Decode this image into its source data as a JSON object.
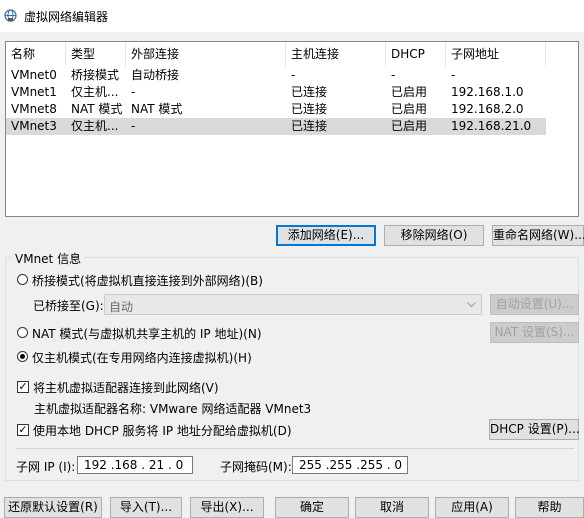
{
  "window": {
    "title": "虚拟网络编辑器",
    "icon": "network-globe-icon"
  },
  "network_table": {
    "columns": [
      "名称",
      "类型",
      "外部连接",
      "主机连接",
      "DHCP",
      "子网地址"
    ],
    "rows": [
      [
        "VMnet0",
        "桥接模式",
        "自动桥接",
        "-",
        "-",
        "-"
      ],
      [
        "VMnet1",
        "仅主机...",
        "-",
        "已连接",
        "已启用",
        "192.168.1.0"
      ],
      [
        "VMnet8",
        "NAT 模式",
        "NAT 模式",
        "已连接",
        "已启用",
        "192.168.2.0"
      ],
      [
        "VMnet3",
        "仅主机...",
        "-",
        "已连接",
        "已启用",
        "192.168.21.0"
      ]
    ],
    "selected_row": 3
  },
  "table_buttons": {
    "add": "添加网络(E)...",
    "remove": "移除网络(O)",
    "rename": "重命名网络(W)..."
  },
  "vmnet_info": {
    "group_label": "VMnet 信息",
    "bridge_radio": "桥接模式(将虚拟机直接连接到外部网络)(B)",
    "bridged_to_label": "已桥接至(G):",
    "bridged_to_value": "自动",
    "auto_settings": "自动设置(U)...",
    "nat_radio": "NAT 模式(与虚拟机共享主机的 IP 地址)(N)",
    "nat_settings": "NAT 设置(S)...",
    "host_only_radio": "仅主机模式(在专用网络内连接虚拟机)(H)",
    "selected_mode": "host-only",
    "connect_adapter_check": "将主机虚拟适配器连接到此网络(V)",
    "connect_adapter_checked": true,
    "adapter_name_label": "主机虚拟适配器名称: VMware 网络适配器 VMnet3",
    "dhcp_check": "使用本地 DHCP 服务将 IP 地址分配给虚拟机(D)",
    "dhcp_checked": true,
    "dhcp_settings": "DHCP 设置(P)...",
    "subnet_ip_label": "子网 IP (I):",
    "subnet_ip_value": "192 .168 . 21  . 0",
    "subnet_mask_label": "子网掩码(M):",
    "subnet_mask_value": "255 .255 .255 . 0"
  },
  "footer_buttons": {
    "restore": "还原默认设置(R)",
    "import": "导入(T)...",
    "export": "导出(X)...",
    "ok": "确定",
    "cancel": "取消",
    "apply": "应用(A)",
    "help": "帮助"
  }
}
